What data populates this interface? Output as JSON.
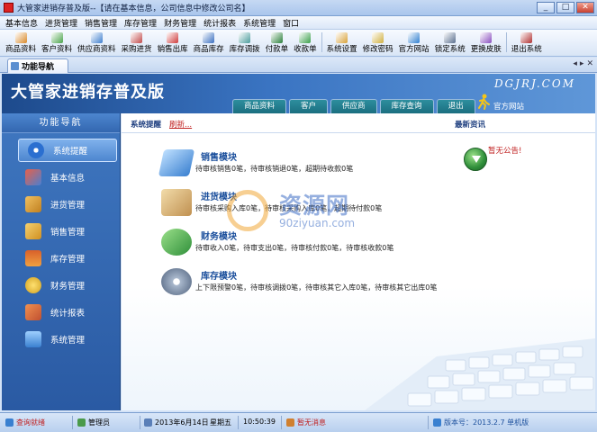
{
  "window": {
    "title": "大管家进销存普及版--【请在基本信息，公司信息中修改公司名】",
    "controls": [
      "_",
      "□",
      "✕"
    ]
  },
  "menu": [
    "基本信息",
    "进货管理",
    "销售管理",
    "库存管理",
    "财务管理",
    "统计报表",
    "系统管理",
    "窗口"
  ],
  "toolbar": [
    {
      "label": "商品资料",
      "icon": "goods-icon",
      "color": "#d98a2b"
    },
    {
      "label": "客户资料",
      "icon": "customer-icon",
      "color": "#4aa34a"
    },
    {
      "label": "供应商资料",
      "icon": "supplier-icon",
      "color": "#3f7fcf"
    },
    {
      "label": "采购进货",
      "icon": "purchase-icon",
      "color": "#c24a4a"
    },
    {
      "label": "销售出库",
      "icon": "sales-icon",
      "color": "#cf3a3a"
    },
    {
      "label": "商品库存",
      "icon": "inventory-icon",
      "color": "#3a6fc0"
    },
    {
      "label": "库存调拨",
      "icon": "transfer-icon",
      "color": "#4b9c9c"
    },
    {
      "label": "付款单",
      "icon": "payment-icon",
      "color": "#2a7f3a"
    },
    {
      "label": "收款单",
      "icon": "receipt-icon",
      "color": "#3a9f4a"
    },
    {
      "label": "系统设置",
      "icon": "settings-icon",
      "color": "#d8a23a"
    },
    {
      "label": "修改密码",
      "icon": "password-icon",
      "color": "#d0b040"
    },
    {
      "label": "官方网站",
      "icon": "website-icon",
      "color": "#2f7fd0"
    },
    {
      "label": "锁定系统",
      "icon": "lock-icon",
      "color": "#5a6f8f"
    },
    {
      "label": "更换皮肤",
      "icon": "skin-icon",
      "color": "#8a4fbf"
    },
    {
      "label": "退出系统",
      "icon": "exit-icon",
      "color": "#b03030"
    }
  ],
  "tab": {
    "label": "功能导航"
  },
  "tab_nav": [
    "◂",
    "▸",
    "✕"
  ],
  "banner": {
    "title": "大管家进销存普及版",
    "site": "DGJRJ.COM",
    "nav": [
      "商品资料",
      "客户",
      "供应商",
      "库存查询",
      "退出"
    ],
    "official": "官方网站"
  },
  "sidebar": {
    "header": "功能导航",
    "items": [
      {
        "label": "系统提醒",
        "icon": "info-icon",
        "color": "#2b6fd0",
        "active": true
      },
      {
        "label": "基本信息",
        "icon": "cube-icon",
        "color": "#d14a3a",
        "active": false
      },
      {
        "label": "进货管理",
        "icon": "box-in-icon",
        "color": "#d9a23a",
        "active": false
      },
      {
        "label": "销售管理",
        "icon": "box-out-icon",
        "color": "#e0b040",
        "active": false
      },
      {
        "label": "库存管理",
        "icon": "house-icon",
        "color": "#d96a2a",
        "active": false
      },
      {
        "label": "财务管理",
        "icon": "coins-icon",
        "color": "#f0c030",
        "active": false
      },
      {
        "label": "统计报表",
        "icon": "people-icon",
        "color": "#e07a3a",
        "active": false
      },
      {
        "label": "系统管理",
        "icon": "monitor-icon",
        "color": "#5aa0e0",
        "active": false
      }
    ]
  },
  "content": {
    "header_title": "系统提醒",
    "refresh": "刷新...",
    "news_title": "最新资讯",
    "news_link": "暂无公告!",
    "modules": [
      {
        "title": "销售模块",
        "desc": "待审核销售0笔，待审核销退0笔，超期待收款0笔",
        "icon": "book-icon",
        "color": "#4a90d8"
      },
      {
        "title": "进货模块",
        "desc": "待审核采购入库0笔，待审核采购入库0笔，超期待付款0笔",
        "icon": "package-icon",
        "color": "#d9b070"
      },
      {
        "title": "财务模块",
        "desc": "待审收入0笔，待审支出0笔，待审核付款0笔，待审核收款0笔",
        "icon": "money-icon",
        "color": "#4aa34a"
      },
      {
        "title": "库存模块",
        "desc": "上下限预警0笔，待审核调拨0笔，待审核其它入库0笔，待审核其它出库0笔",
        "icon": "disk-icon",
        "color": "#8a9fb8"
      }
    ],
    "watermark": {
      "big": "资源网",
      "small": "90ziyuan.com"
    }
  },
  "statusbar": {
    "status": "查询就绪",
    "user": "管理员",
    "date": "2013年6月14日",
    "weekday": "星期五",
    "time": "10:50:39",
    "message": "暂无消息",
    "version": "版本号：2013.2.7 单机版"
  }
}
